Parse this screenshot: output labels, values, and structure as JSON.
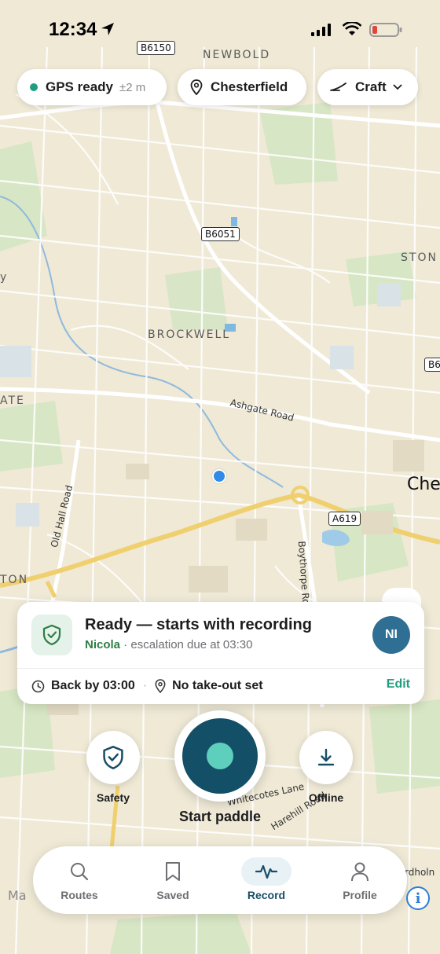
{
  "status_bar": {
    "time": "12:34"
  },
  "map": {
    "places": [
      "NEWBOLD",
      "BROCKWELL",
      "STON",
      "ATE",
      "TON"
    ],
    "city": "Che",
    "road_shields": [
      "B6150",
      "B6051",
      "A619",
      "B6"
    ],
    "road_names": [
      "Ashgate Road",
      "Old Hall Road",
      "Boythorpe Ro",
      "Whitecotes Lane",
      "Harehill Road",
      "rdholn"
    ],
    "left_edge_letter": "y",
    "attribution": "Ma"
  },
  "top_pills": {
    "gps_label": "GPS ready",
    "gps_accuracy": "±2 m",
    "location": "Chesterfield",
    "craft": "Craft"
  },
  "safety_card": {
    "title": "Ready — starts with recording",
    "contact_name": "Nicola",
    "detail": " · escalation due at 03:30",
    "avatar_initials": "NI",
    "back_by": "Back by 03:00",
    "separator": "·",
    "takeout": "No take-out set",
    "edit_label": "Edit"
  },
  "actions": {
    "safety_label": "Safety",
    "start_label": "Start paddle",
    "offline_label": "Offline"
  },
  "tabs": [
    {
      "label": "Routes"
    },
    {
      "label": "Saved"
    },
    {
      "label": "Record"
    },
    {
      "label": "Profile"
    }
  ],
  "colors": {
    "accent_green": "#1e9e7e",
    "record_dark": "#134f67",
    "record_core": "#5ecfbd",
    "avatar_bg": "#2f6f93",
    "map_bg": "#efe9d6"
  }
}
